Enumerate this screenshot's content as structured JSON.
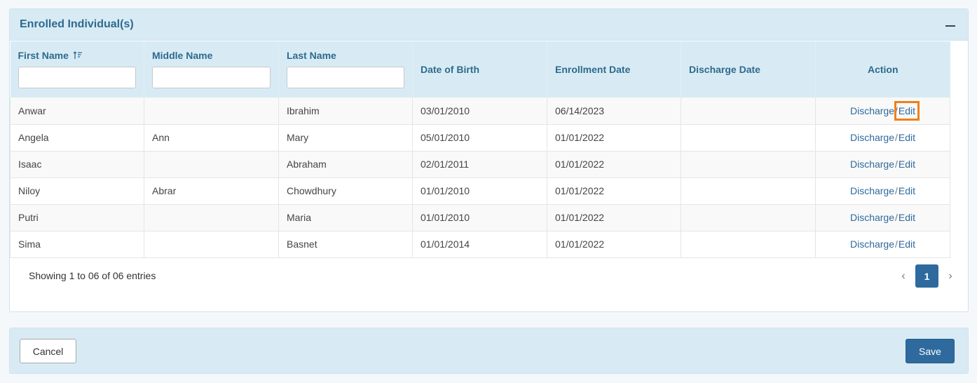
{
  "panel": {
    "title": "Enrolled Individual(s)"
  },
  "table": {
    "headers": {
      "first_name": "First Name",
      "middle_name": "Middle Name",
      "last_name": "Last Name",
      "dob": "Date of Birth",
      "enrollment": "Enrollment Date",
      "discharge": "Discharge Date",
      "action": "Action"
    },
    "rows": [
      {
        "first": "Anwar",
        "middle": "",
        "last": "Ibrahim",
        "dob": "03/01/2010",
        "enroll": "06/14/2023",
        "discharge": ""
      },
      {
        "first": "Angela",
        "middle": "Ann",
        "last": "Mary",
        "dob": "05/01/2010",
        "enroll": "01/01/2022",
        "discharge": ""
      },
      {
        "first": "Isaac",
        "middle": "",
        "last": "Abraham",
        "dob": "02/01/2011",
        "enroll": "01/01/2022",
        "discharge": ""
      },
      {
        "first": "Niloy",
        "middle": "Abrar",
        "last": "Chowdhury",
        "dob": "01/01/2010",
        "enroll": "01/01/2022",
        "discharge": ""
      },
      {
        "first": "Putri",
        "middle": "",
        "last": "Maria",
        "dob": "01/01/2010",
        "enroll": "01/01/2022",
        "discharge": ""
      },
      {
        "first": "Sima",
        "middle": "",
        "last": "Basnet",
        "dob": "01/01/2014",
        "enroll": "01/01/2022",
        "discharge": ""
      }
    ],
    "actions": {
      "discharge": "Discharge",
      "separator": "/",
      "edit": "Edit"
    }
  },
  "footer": {
    "info": "Showing 1 to 06 of 06 entries",
    "prev": "‹",
    "next": "›",
    "current_page": "1"
  },
  "buttons": {
    "cancel": "Cancel",
    "save": "Save"
  },
  "colors": {
    "accent": "#2e6a9e",
    "header_bg": "#d8ebf4",
    "highlight": "#f07f1b"
  }
}
